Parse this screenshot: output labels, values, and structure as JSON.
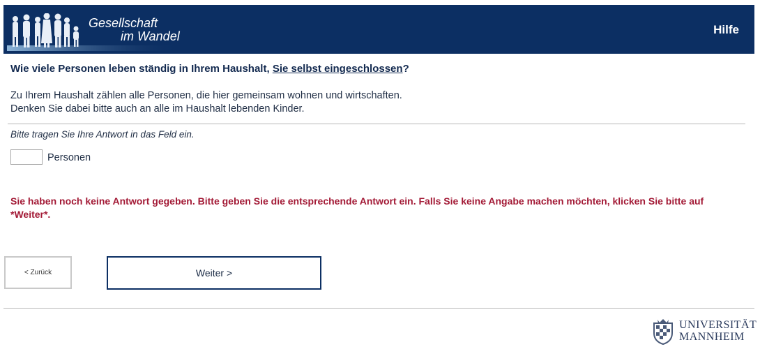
{
  "header": {
    "logo_line1": "Gesellschaft",
    "logo_line2": "im Wandel",
    "help_label": "Hilfe"
  },
  "question": {
    "text_before": "Wie viele Personen leben ständig in Ihrem Haushalt, ",
    "link_text": "Sie selbst eingeschlossen",
    "text_after": "?"
  },
  "instructions": {
    "line1": "Zu Ihrem Haushalt zählen alle Personen, die hier gemeinsam wohnen und wirtschaften.",
    "line2": "Denken Sie dabei bitte auch an alle im Haushalt lebenden Kinder."
  },
  "hint": "Bitte tragen Sie Ihre Antwort in das Feld ein.",
  "answer": {
    "value": "",
    "unit_label": "Personen"
  },
  "error_message": "Sie haben noch keine Antwort gegeben. Bitte geben Sie die entsprechende Antwort ein. Falls Sie keine Angabe machen möchten, klicken Sie bitte auf *Weiter*.",
  "navigation": {
    "back_label": "< Zurück",
    "next_label": "Weiter >"
  },
  "footer": {
    "university_line1": "UNIVERSITÄT",
    "university_line2": "MANNHEIM"
  },
  "colors": {
    "header_bg": "#0c2f63",
    "error_text": "#a31a36"
  }
}
